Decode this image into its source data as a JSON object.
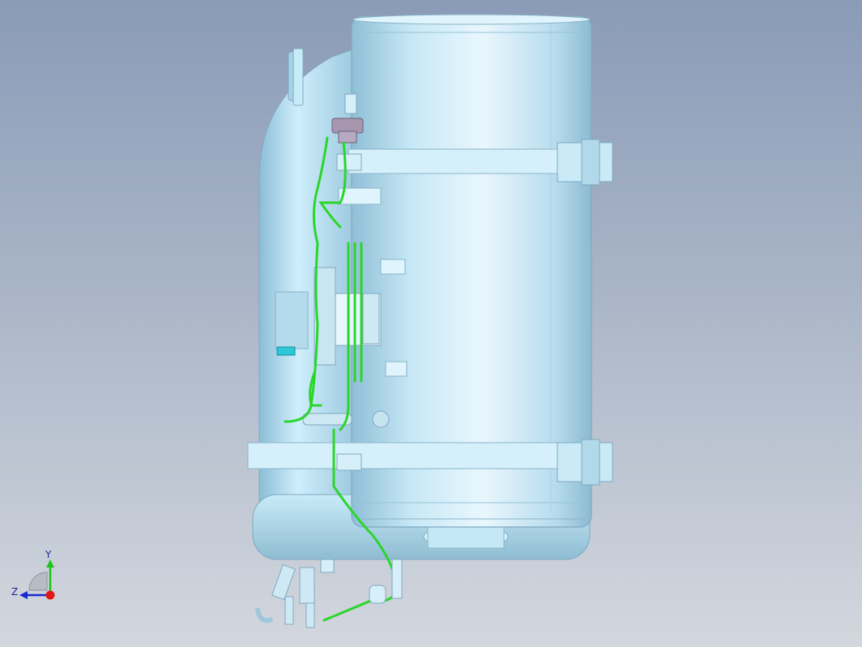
{
  "viewport": {
    "background_top": "#8a9bb8",
    "background_bottom": "#d3d7de",
    "model_color": "#bfe4f3",
    "tube_color": "#2bd62b",
    "cap_color": "#9a8aa6"
  },
  "triad": {
    "y_label": "Y",
    "z_label": "Z",
    "y_color": "#1ec31e",
    "z_color": "#1a2ad0",
    "x_color": "#e01818"
  }
}
